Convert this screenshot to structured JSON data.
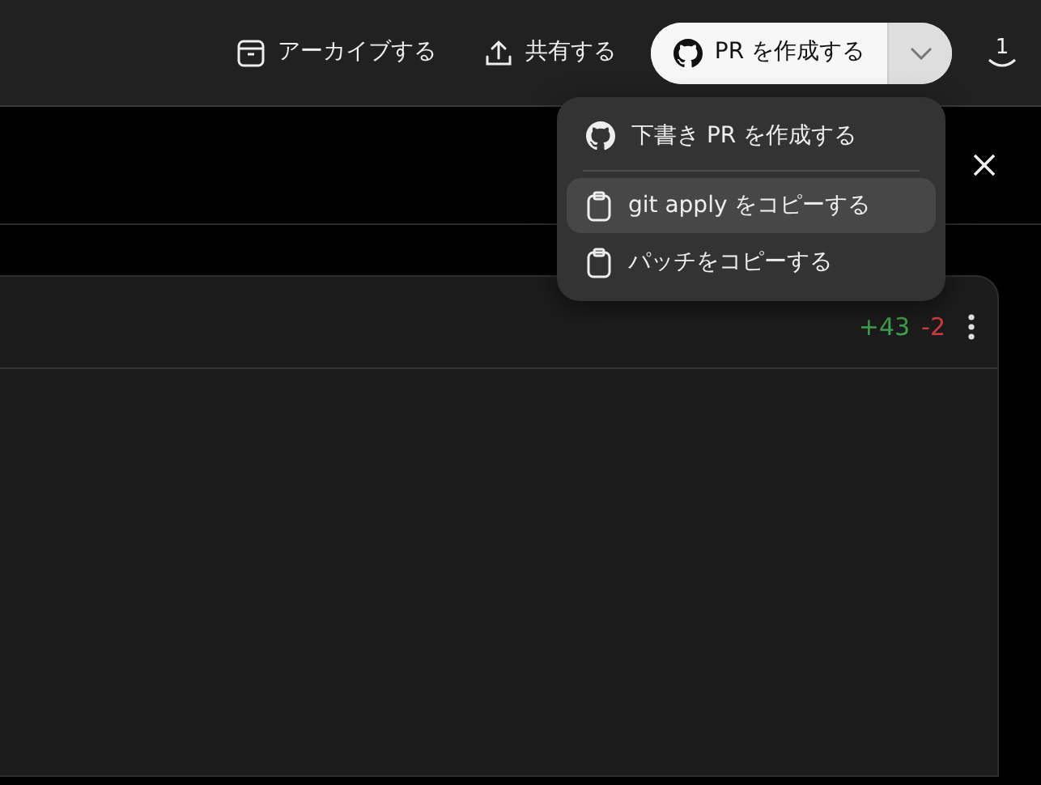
{
  "toolbar": {
    "archive_label": "アーカイブする",
    "share_label": "共有する",
    "create_pr_label": "PR を作成する",
    "badge": "1"
  },
  "card": {
    "additions": "+43",
    "deletions": "-2"
  },
  "menu": {
    "items": [
      {
        "kind": "github",
        "label": "下書き PR を作成する",
        "selected": false
      },
      {
        "kind": "divider"
      },
      {
        "kind": "clipboard",
        "label": "git apply をコピーする",
        "selected": true
      },
      {
        "kind": "clipboard",
        "label": "パッチをコピーする",
        "selected": false
      }
    ]
  }
}
